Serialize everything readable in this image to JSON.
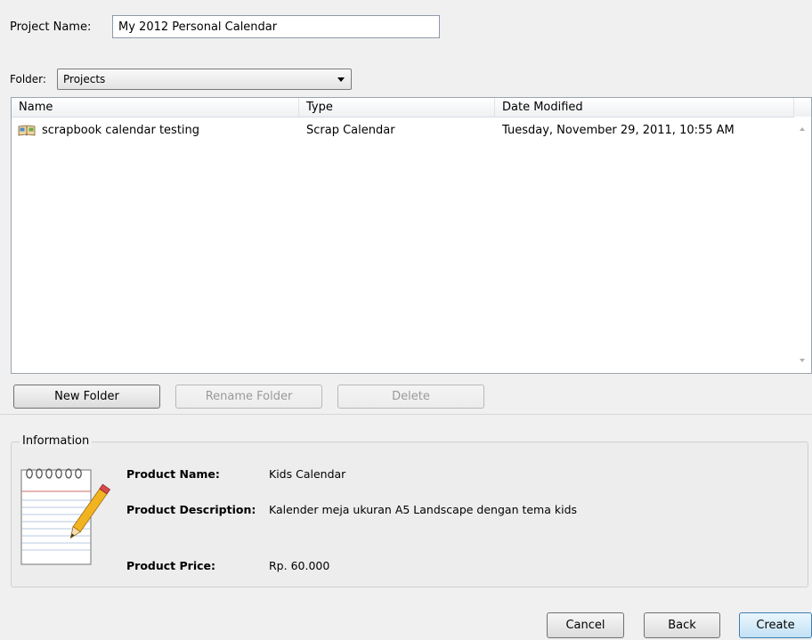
{
  "project": {
    "label": "Project Name:",
    "value": "My 2012 Personal Calendar"
  },
  "folder": {
    "label": "Folder:",
    "selected": "Projects"
  },
  "list": {
    "columns": [
      "Name",
      "Type",
      "Date Modified"
    ],
    "rows": [
      {
        "name": "scrapbook calendar testing",
        "type": "Scrap Calendar",
        "date": "Tuesday, November 29, 2011, 10:55 AM",
        "icon": "book-icon"
      }
    ]
  },
  "folder_actions": {
    "new_folder": "New Folder",
    "rename_folder": "Rename Folder",
    "delete": "Delete"
  },
  "information": {
    "title": "Information",
    "product_name_label": "Product Name:",
    "product_name": "Kids Calendar",
    "product_description_label": "Product Description:",
    "product_description": "Kalender meja ukuran A5 Landscape dengan tema kids",
    "product_price_label": "Product Price:",
    "product_price": "Rp. 60.000",
    "icon": "notepad-pencil-icon"
  },
  "dialog_buttons": {
    "cancel": "Cancel",
    "back": "Back",
    "create": "Create"
  }
}
